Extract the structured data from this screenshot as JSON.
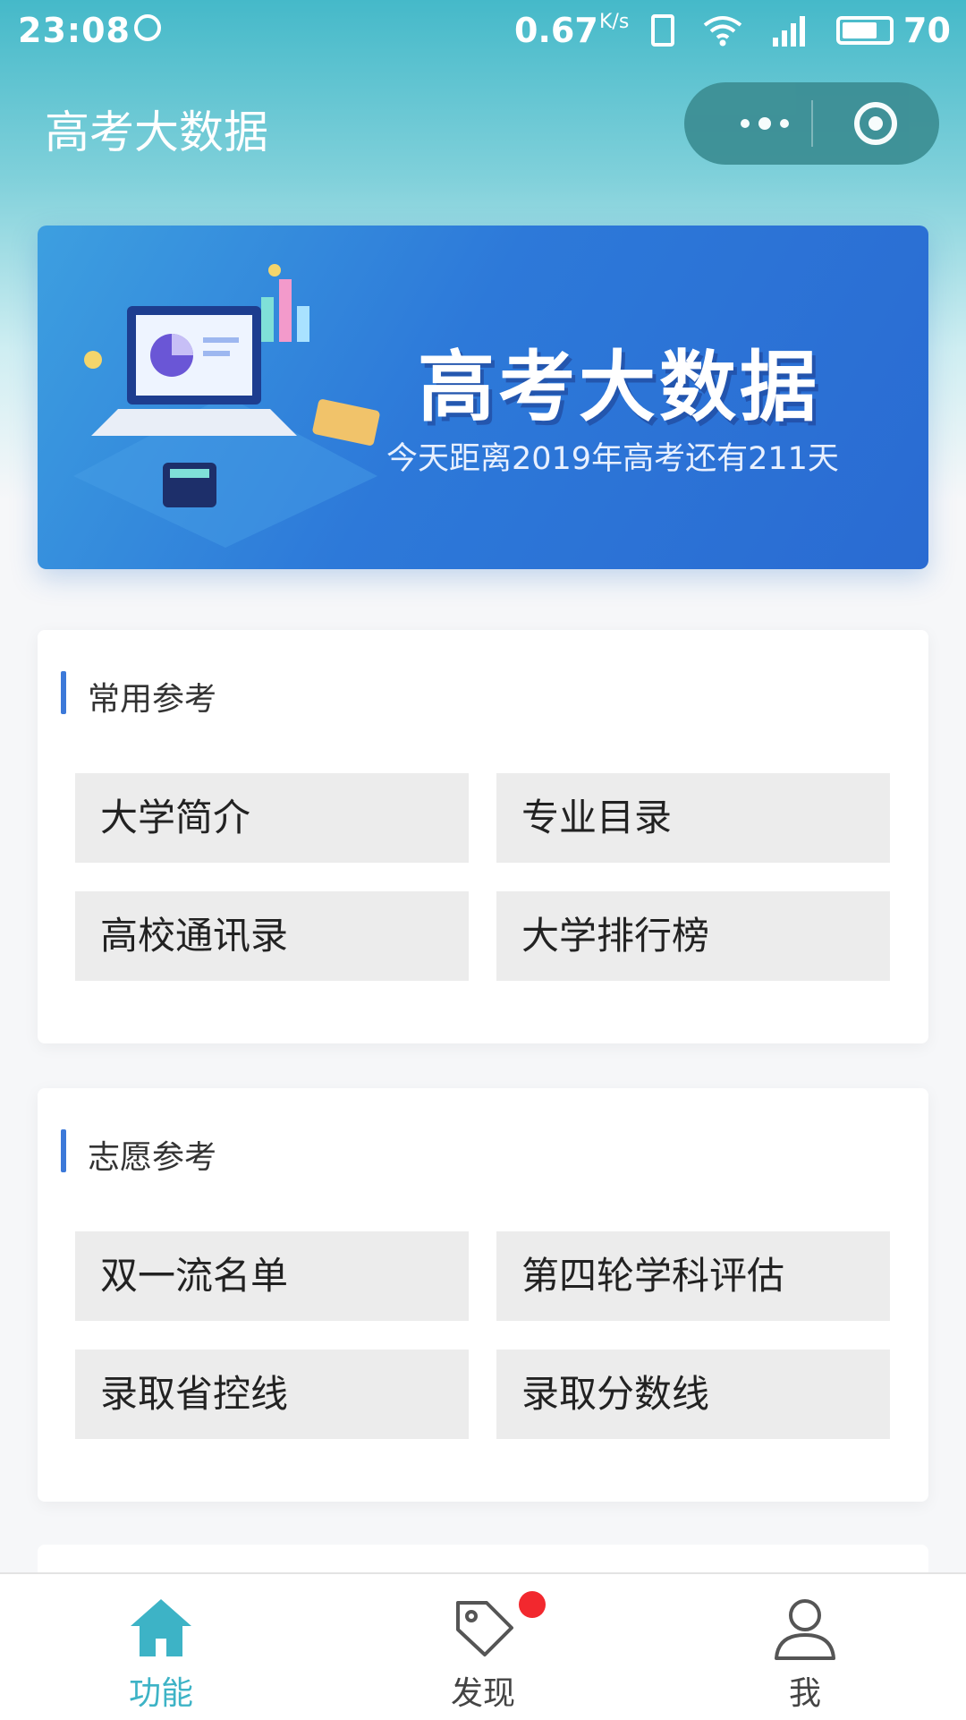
{
  "status_bar": {
    "time": "23:08",
    "speed": "0.67",
    "speed_unit": "K/s",
    "battery": "70"
  },
  "nav": {
    "title": "高考大数据"
  },
  "banner": {
    "title": "高考大数据",
    "subtitle": "今天距离2019年高考还有211天"
  },
  "sections": [
    {
      "title": "常用参考",
      "items": [
        "大学简介",
        "专业目录",
        "高校通讯录",
        "大学排行榜"
      ]
    },
    {
      "title": "志愿参考",
      "items": [
        "双一流名单",
        "第四轮学科评估",
        "录取省控线",
        "录取分数线"
      ]
    }
  ],
  "tab_bar": {
    "tabs": [
      {
        "label": "功能",
        "icon": "home-icon",
        "active": true
      },
      {
        "label": "发现",
        "icon": "tag-icon",
        "active": false
      },
      {
        "label": "我",
        "icon": "user-icon",
        "active": false
      }
    ],
    "active_color": "#3db3c6"
  },
  "colors": {
    "header_teal": "#45b9c9",
    "accent_blue": "#3c79d9",
    "badge_red": "#f2282e"
  }
}
